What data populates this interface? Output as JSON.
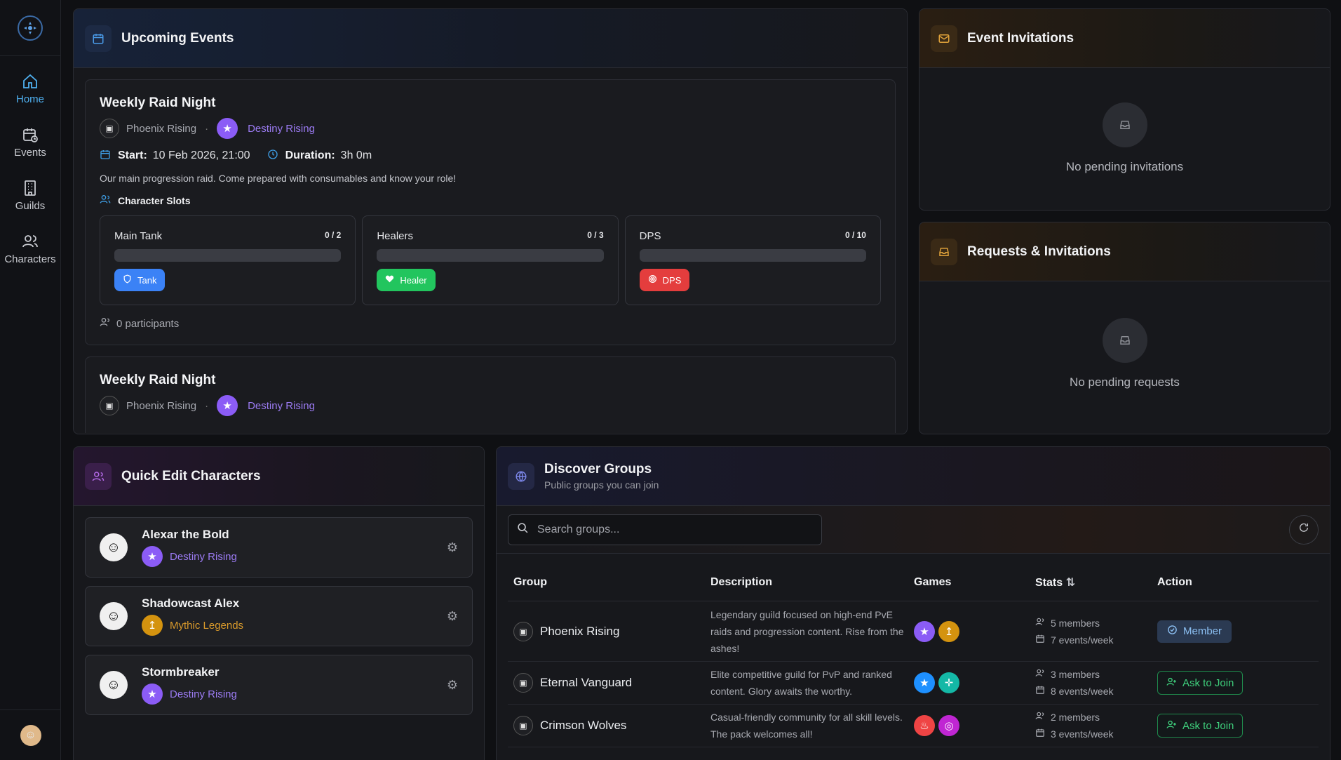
{
  "sidebar": {
    "items": [
      {
        "label": "Home",
        "icon": "home-icon"
      },
      {
        "label": "Events",
        "icon": "calendar-icon"
      },
      {
        "label": "Guilds",
        "icon": "building-icon"
      },
      {
        "label": "Characters",
        "icon": "users-icon"
      }
    ]
  },
  "upcoming": {
    "title": "Upcoming Events",
    "events": [
      {
        "title": "Weekly Raid Night",
        "guild": "Phoenix Rising",
        "game": "Destiny Rising",
        "start_label": "Start:",
        "start": "10 Feb 2026, 21:00",
        "duration_label": "Duration:",
        "duration": "3h 0m",
        "description": "Our main progression raid. Come prepared with consumables and know your role!",
        "slots_title": "Character Slots",
        "slots": [
          {
            "name": "Main Tank",
            "count": "0 / 2",
            "role": "Tank",
            "fill": 0
          },
          {
            "name": "Healers",
            "count": "0 / 3",
            "role": "Healer",
            "fill": 0
          },
          {
            "name": "DPS",
            "count": "0 / 10",
            "role": "DPS",
            "fill": 0
          }
        ],
        "participants": "0 participants"
      },
      {
        "title": "Weekly Raid Night",
        "guild": "Phoenix Rising",
        "game": "Destiny Rising"
      }
    ]
  },
  "invitations": {
    "title": "Event Invitations",
    "empty": "No pending invitations"
  },
  "requests": {
    "title": "Requests & Invitations",
    "empty": "No pending requests"
  },
  "quickedit": {
    "title": "Quick Edit Characters",
    "characters": [
      {
        "name": "Alexar the Bold",
        "game": "Destiny Rising",
        "game_color": "purple"
      },
      {
        "name": "Shadowcast Alex",
        "game": "Mythic Legends",
        "game_color": "gold"
      },
      {
        "name": "Stormbreaker",
        "game": "Destiny Rising",
        "game_color": "purple"
      }
    ]
  },
  "discover": {
    "title": "Discover Groups",
    "subtitle": "Public groups you can join",
    "search_placeholder": "Search groups...",
    "columns": [
      "Group",
      "Description",
      "Games",
      "Stats",
      "Action"
    ],
    "rows": [
      {
        "group": "Phoenix Rising",
        "description": "Legendary guild focused on high-end PvE raids and progression content. Rise from the ashes!",
        "members": "5 members",
        "events": "7 events/week",
        "action": "Member"
      },
      {
        "group": "Eternal Vanguard",
        "description": "Elite competitive guild for PvP and ranked content. Glory awaits the worthy.",
        "members": "3 members",
        "events": "8 events/week",
        "action": "Ask to Join"
      },
      {
        "group": "Crimson Wolves",
        "description": "Casual-friendly community for all skill levels. The pack welcomes all!",
        "members": "2 members",
        "events": "3 events/week",
        "action": "Ask to Join"
      }
    ]
  }
}
